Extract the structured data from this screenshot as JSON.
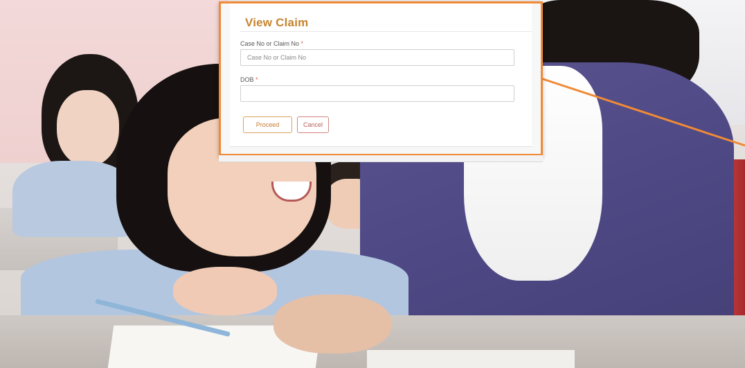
{
  "dialog": {
    "title": "View Claim",
    "case_field": {
      "label": "Case No or Claim No",
      "required_marker": "*",
      "placeholder": "Case No or Claim No",
      "value": ""
    },
    "dob_field": {
      "label": "DOB",
      "required_marker": "*",
      "placeholder": "",
      "value": ""
    },
    "buttons": {
      "proceed_label": "Proceed",
      "cancel_label": "Cancel"
    }
  },
  "colors": {
    "accent_orange": "#f08a36",
    "title_gold": "#c6842f",
    "required_red": "#e05a5a",
    "cancel_red": "#b85d5d"
  }
}
